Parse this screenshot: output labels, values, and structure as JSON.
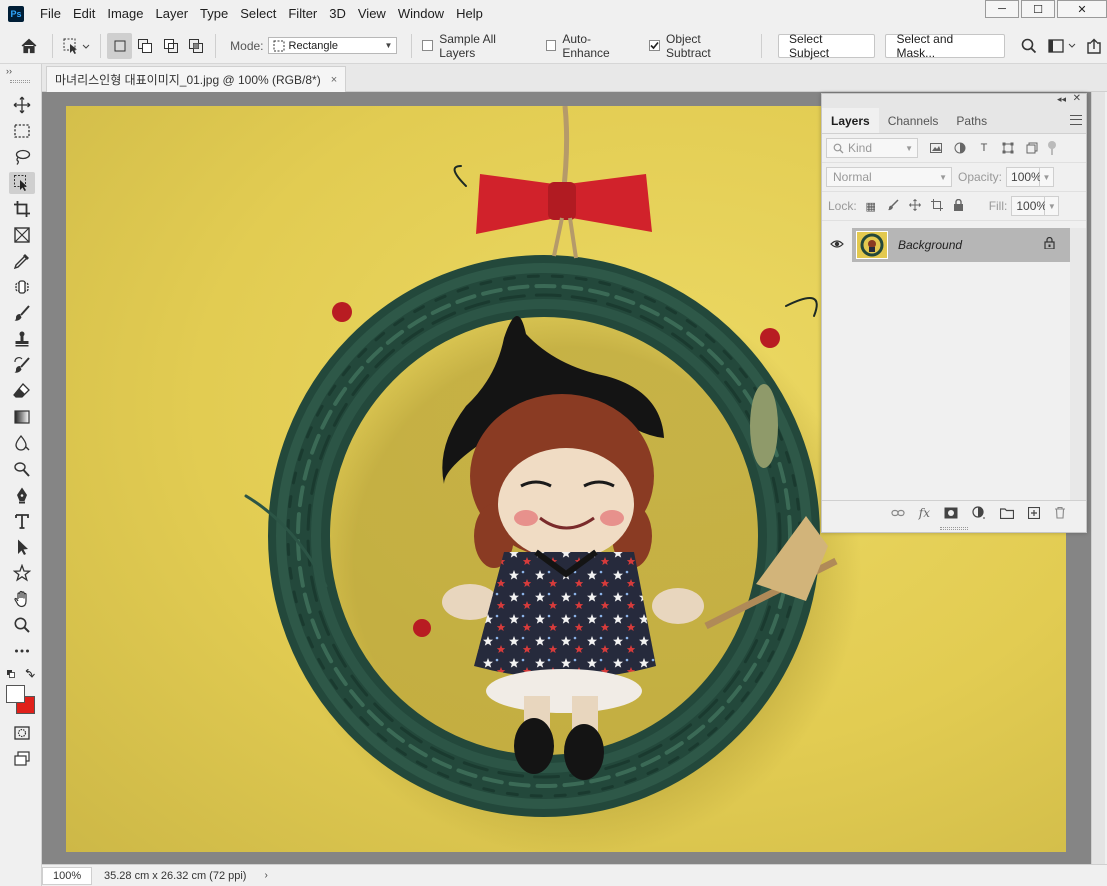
{
  "app": {
    "logo_text": "Ps",
    "menu": [
      "File",
      "Edit",
      "Image",
      "Layer",
      "Type",
      "Select",
      "Filter",
      "3D",
      "View",
      "Window",
      "Help"
    ],
    "window_controls": [
      "─",
      "☐",
      "✕"
    ]
  },
  "options_bar": {
    "mode_label": "Mode:",
    "mode_value": "Rectangle",
    "sample_all_layers": {
      "label": "Sample All Layers",
      "checked": false
    },
    "auto_enhance": {
      "label": "Auto-Enhance",
      "checked": false
    },
    "object_subtract": {
      "label": "Object Subtract",
      "checked": true
    },
    "select_subject": "Select Subject",
    "select_and_mask": "Select and Mask..."
  },
  "document": {
    "tab_title": "마녀리스인형 대표이미지_01.jpg @ 100% (RGB/8*)",
    "tab_close": "×"
  },
  "tools_collapse": "››",
  "tools": [
    {
      "name": "move-tool",
      "icon": "move-icon"
    },
    {
      "name": "marquee-tool",
      "icon": "marquee-icon"
    },
    {
      "name": "lasso-tool",
      "icon": "lasso-icon"
    },
    {
      "name": "object-selection-tool",
      "icon": "object-selection-icon",
      "active": true
    },
    {
      "name": "crop-tool",
      "icon": "crop-icon"
    },
    {
      "name": "frame-tool",
      "icon": "frame-icon"
    },
    {
      "name": "eyedropper-tool",
      "icon": "eyedropper-icon"
    },
    {
      "name": "spot-healing-tool",
      "icon": "healing-icon"
    },
    {
      "name": "brush-tool",
      "icon": "brush-icon"
    },
    {
      "name": "clone-stamp-tool",
      "icon": "stamp-icon"
    },
    {
      "name": "history-brush-tool",
      "icon": "history-brush-icon"
    },
    {
      "name": "eraser-tool",
      "icon": "eraser-icon"
    },
    {
      "name": "gradient-tool",
      "icon": "gradient-icon"
    },
    {
      "name": "blur-tool",
      "icon": "blur-icon"
    },
    {
      "name": "dodge-tool",
      "icon": "dodge-icon"
    },
    {
      "name": "pen-tool",
      "icon": "pen-icon"
    },
    {
      "name": "type-tool",
      "icon": "type-icon"
    },
    {
      "name": "path-selection-tool",
      "icon": "path-selection-icon"
    },
    {
      "name": "shape-tool",
      "icon": "shape-icon"
    },
    {
      "name": "hand-tool",
      "icon": "hand-icon"
    },
    {
      "name": "zoom-tool",
      "icon": "zoom-icon"
    },
    {
      "name": "more-tools",
      "icon": "ellipsis-icon"
    }
  ],
  "colors": {
    "foreground": "#ffffff",
    "background": "#e0201a"
  },
  "status": {
    "zoom": "100%",
    "doc_size": "35.28 cm x 26.32 cm (72 ppi)",
    "arrow": "›"
  },
  "layers_panel": {
    "tabs": [
      "Layers",
      "Channels",
      "Paths"
    ],
    "active_tab": "Layers",
    "kind_label": "Kind",
    "blend_mode": "Normal",
    "opacity_label": "Opacity:",
    "opacity_value": "100%",
    "lock_label": "Lock:",
    "fill_label": "Fill:",
    "fill_value": "100%",
    "layers": [
      {
        "name": "Background",
        "visible": true,
        "locked": true
      }
    ],
    "bottom_icons": [
      "link-icon",
      "fx-icon",
      "mask-icon",
      "adjustment-icon",
      "group-icon",
      "new-layer-icon",
      "delete-icon"
    ],
    "fx_label": "fx"
  }
}
